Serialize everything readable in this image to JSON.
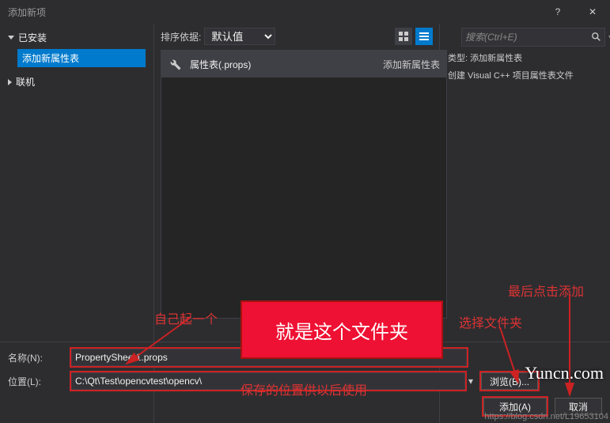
{
  "titlebar": {
    "title": "添加新项"
  },
  "tree": {
    "installed": "已安装",
    "selected": "添加新属性表",
    "online": "联机"
  },
  "tools": {
    "sort_label": "排序依据:",
    "sort_value": "默认值",
    "search_placeholder": "搜索(Ctrl+E)"
  },
  "template": {
    "name": "属性表(.props)",
    "tag": "添加新属性表"
  },
  "right": {
    "type_label": "类型:",
    "type_value": "添加新属性表",
    "desc": "创建 Visual C++ 项目属性表文件"
  },
  "form": {
    "name_label": "名称(N):",
    "name_value": "PropertySheet1.props",
    "loc_label": "位置(L):",
    "loc_value": "C:\\Qt\\Test\\opencvtest\\opencv\\",
    "browse": "浏览(B)...",
    "add": "添加(A)",
    "cancel": "取消"
  },
  "annotations": {
    "own_name": "自己起一个",
    "overlay": "就是这个文件夹",
    "save_note": "保存的位置供以后使用",
    "choose_folder": "选择文件夹",
    "click_add": "最后点击添加",
    "watermark": "Yuncn.com",
    "csdn": "https://blog.csdn.net/L19653104"
  }
}
